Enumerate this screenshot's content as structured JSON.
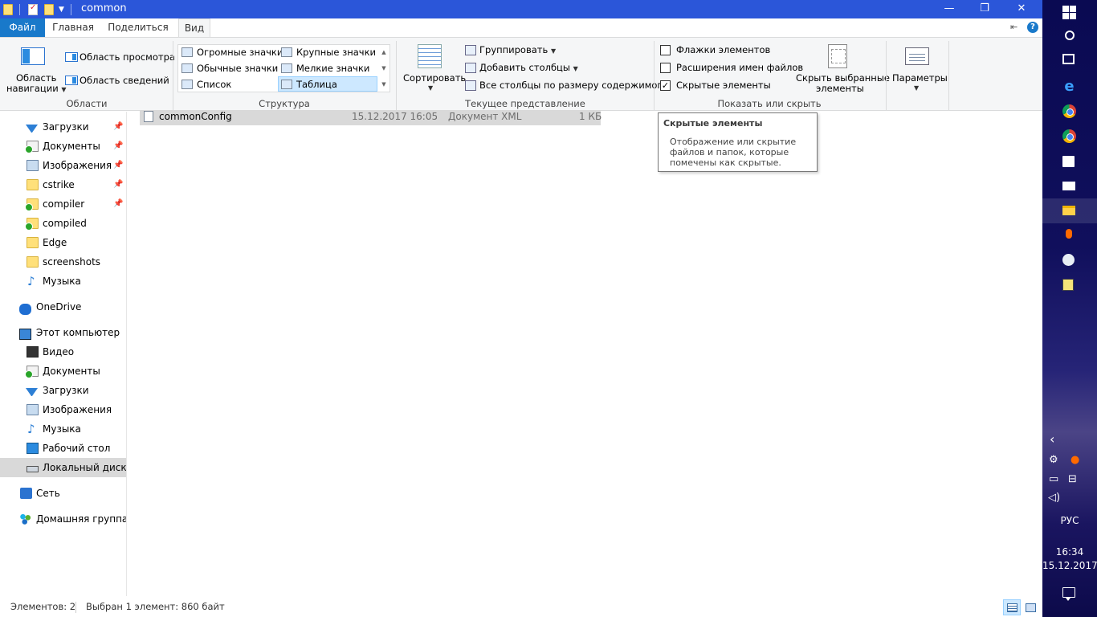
{
  "window": {
    "title": "common",
    "minimize": "—",
    "maximize": "❐",
    "close": "✕"
  },
  "ribbon_tabs": {
    "file": "Файл",
    "home": "Главная",
    "share": "Поделиться",
    "view": "Вид"
  },
  "ribbon": {
    "panes": {
      "nav_pane_line1": "Область",
      "nav_pane_line2": "навигации",
      "preview_pane": "Область просмотра",
      "details_pane": "Область сведений",
      "group": "Области"
    },
    "layout": {
      "extra_large": "Огромные значки",
      "large": "Крупные значки",
      "medium": "Обычные значки",
      "small": "Мелкие значки",
      "list": "Список",
      "details": "Таблица",
      "selected": "Таблица",
      "group": "Структура"
    },
    "current_view": {
      "sort": "Сортировать",
      "group_by": "Группировать",
      "add_columns": "Добавить столбцы",
      "size_columns": "Все столбцы по размеру содержимого",
      "group": "Текущее представление"
    },
    "show_hide": {
      "item_checkboxes": "Флажки элементов",
      "item_checkboxes_checked": false,
      "file_extensions": "Расширения имен файлов",
      "file_extensions_checked": false,
      "hidden_items": "Скрытые элементы",
      "hidden_items_checked": true,
      "hide_selected_line1": "Скрыть выбранные",
      "hide_selected_line2": "элементы",
      "group": "Показать или скрыть"
    },
    "options": {
      "label": "Параметры"
    }
  },
  "nav": {
    "quick_access": [
      {
        "label": "Загрузки",
        "icon": "download-icon",
        "pinned": true
      },
      {
        "label": "Документы",
        "icon": "documents-icon",
        "pinned": true
      },
      {
        "label": "Изображения",
        "icon": "pictures-icon",
        "pinned": true
      },
      {
        "label": "cstrike",
        "icon": "folder-icon",
        "pinned": true
      },
      {
        "label": "compiler",
        "icon": "folder-icon",
        "pinned": true
      },
      {
        "label": "compiled",
        "icon": "folder-icon",
        "pinned": false
      },
      {
        "label": "Edge",
        "icon": "folder-icon",
        "pinned": false
      },
      {
        "label": "screenshots",
        "icon": "folder-icon",
        "pinned": false
      },
      {
        "label": "Музыка",
        "icon": "music-icon",
        "pinned": false
      }
    ],
    "onedrive": "OneDrive",
    "this_pc": "Этот компьютер",
    "pc_items": [
      {
        "label": "Видео",
        "icon": "video-icon"
      },
      {
        "label": "Документы",
        "icon": "documents-icon"
      },
      {
        "label": "Загрузки",
        "icon": "download-icon"
      },
      {
        "label": "Изображения",
        "icon": "pictures-icon"
      },
      {
        "label": "Музыка",
        "icon": "music-icon"
      },
      {
        "label": "Рабочий стол",
        "icon": "desktop-icon"
      },
      {
        "label": "Локальный диск (C",
        "icon": "disk-icon"
      }
    ],
    "network": "Сеть",
    "homegroup": "Домашняя группа"
  },
  "files": [
    {
      "name": "commonConfig",
      "date": "15.12.2017 16:05",
      "type": "Документ XML",
      "size": "1 КБ"
    }
  ],
  "tooltip": {
    "title": "Скрытые элементы",
    "body": "Отображение или скрытие файлов и папок, которые помечены как скрытые."
  },
  "status": {
    "count": "Элементов: 2",
    "selection": "Выбран 1 элемент: 860 байт"
  },
  "taskbar": {
    "language": "РУС",
    "time": "16:34",
    "date": "15.12.2017"
  },
  "colors": {
    "title_bar": "#2b56d9",
    "file_tab": "#1979ca",
    "selection": "#cde8ff",
    "ribbon_bg": "#f5f6f7"
  }
}
